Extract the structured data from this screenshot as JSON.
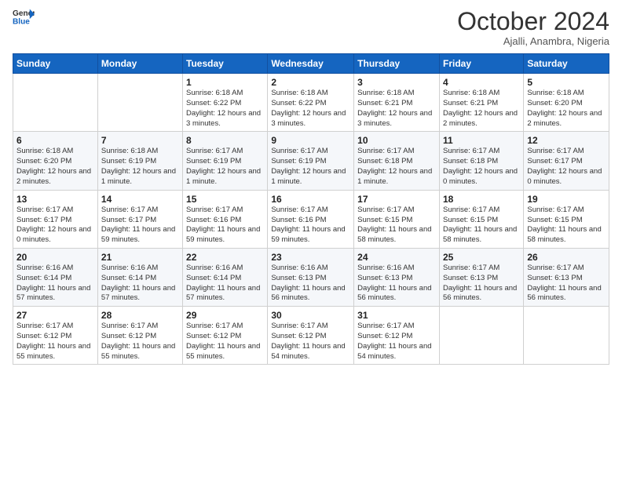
{
  "header": {
    "logo": {
      "general": "General",
      "blue": "Blue"
    },
    "title": "October 2024",
    "subtitle": "Ajalli, Anambra, Nigeria"
  },
  "days_of_week": [
    "Sunday",
    "Monday",
    "Tuesday",
    "Wednesday",
    "Thursday",
    "Friday",
    "Saturday"
  ],
  "weeks": [
    [
      {
        "day": "",
        "info": ""
      },
      {
        "day": "",
        "info": ""
      },
      {
        "day": "1",
        "info": "Sunrise: 6:18 AM\nSunset: 6:22 PM\nDaylight: 12 hours and 3 minutes."
      },
      {
        "day": "2",
        "info": "Sunrise: 6:18 AM\nSunset: 6:22 PM\nDaylight: 12 hours and 3 minutes."
      },
      {
        "day": "3",
        "info": "Sunrise: 6:18 AM\nSunset: 6:21 PM\nDaylight: 12 hours and 3 minutes."
      },
      {
        "day": "4",
        "info": "Sunrise: 6:18 AM\nSunset: 6:21 PM\nDaylight: 12 hours and 2 minutes."
      },
      {
        "day": "5",
        "info": "Sunrise: 6:18 AM\nSunset: 6:20 PM\nDaylight: 12 hours and 2 minutes."
      }
    ],
    [
      {
        "day": "6",
        "info": "Sunrise: 6:18 AM\nSunset: 6:20 PM\nDaylight: 12 hours and 2 minutes."
      },
      {
        "day": "7",
        "info": "Sunrise: 6:18 AM\nSunset: 6:19 PM\nDaylight: 12 hours and 1 minute."
      },
      {
        "day": "8",
        "info": "Sunrise: 6:17 AM\nSunset: 6:19 PM\nDaylight: 12 hours and 1 minute."
      },
      {
        "day": "9",
        "info": "Sunrise: 6:17 AM\nSunset: 6:19 PM\nDaylight: 12 hours and 1 minute."
      },
      {
        "day": "10",
        "info": "Sunrise: 6:17 AM\nSunset: 6:18 PM\nDaylight: 12 hours and 1 minute."
      },
      {
        "day": "11",
        "info": "Sunrise: 6:17 AM\nSunset: 6:18 PM\nDaylight: 12 hours and 0 minutes."
      },
      {
        "day": "12",
        "info": "Sunrise: 6:17 AM\nSunset: 6:17 PM\nDaylight: 12 hours and 0 minutes."
      }
    ],
    [
      {
        "day": "13",
        "info": "Sunrise: 6:17 AM\nSunset: 6:17 PM\nDaylight: 12 hours and 0 minutes."
      },
      {
        "day": "14",
        "info": "Sunrise: 6:17 AM\nSunset: 6:17 PM\nDaylight: 11 hours and 59 minutes."
      },
      {
        "day": "15",
        "info": "Sunrise: 6:17 AM\nSunset: 6:16 PM\nDaylight: 11 hours and 59 minutes."
      },
      {
        "day": "16",
        "info": "Sunrise: 6:17 AM\nSunset: 6:16 PM\nDaylight: 11 hours and 59 minutes."
      },
      {
        "day": "17",
        "info": "Sunrise: 6:17 AM\nSunset: 6:15 PM\nDaylight: 11 hours and 58 minutes."
      },
      {
        "day": "18",
        "info": "Sunrise: 6:17 AM\nSunset: 6:15 PM\nDaylight: 11 hours and 58 minutes."
      },
      {
        "day": "19",
        "info": "Sunrise: 6:17 AM\nSunset: 6:15 PM\nDaylight: 11 hours and 58 minutes."
      }
    ],
    [
      {
        "day": "20",
        "info": "Sunrise: 6:16 AM\nSunset: 6:14 PM\nDaylight: 11 hours and 57 minutes."
      },
      {
        "day": "21",
        "info": "Sunrise: 6:16 AM\nSunset: 6:14 PM\nDaylight: 11 hours and 57 minutes."
      },
      {
        "day": "22",
        "info": "Sunrise: 6:16 AM\nSunset: 6:14 PM\nDaylight: 11 hours and 57 minutes."
      },
      {
        "day": "23",
        "info": "Sunrise: 6:16 AM\nSunset: 6:13 PM\nDaylight: 11 hours and 56 minutes."
      },
      {
        "day": "24",
        "info": "Sunrise: 6:16 AM\nSunset: 6:13 PM\nDaylight: 11 hours and 56 minutes."
      },
      {
        "day": "25",
        "info": "Sunrise: 6:17 AM\nSunset: 6:13 PM\nDaylight: 11 hours and 56 minutes."
      },
      {
        "day": "26",
        "info": "Sunrise: 6:17 AM\nSunset: 6:13 PM\nDaylight: 11 hours and 56 minutes."
      }
    ],
    [
      {
        "day": "27",
        "info": "Sunrise: 6:17 AM\nSunset: 6:12 PM\nDaylight: 11 hours and 55 minutes."
      },
      {
        "day": "28",
        "info": "Sunrise: 6:17 AM\nSunset: 6:12 PM\nDaylight: 11 hours and 55 minutes."
      },
      {
        "day": "29",
        "info": "Sunrise: 6:17 AM\nSunset: 6:12 PM\nDaylight: 11 hours and 55 minutes."
      },
      {
        "day": "30",
        "info": "Sunrise: 6:17 AM\nSunset: 6:12 PM\nDaylight: 11 hours and 54 minutes."
      },
      {
        "day": "31",
        "info": "Sunrise: 6:17 AM\nSunset: 6:12 PM\nDaylight: 11 hours and 54 minutes."
      },
      {
        "day": "",
        "info": ""
      },
      {
        "day": "",
        "info": ""
      }
    ]
  ]
}
